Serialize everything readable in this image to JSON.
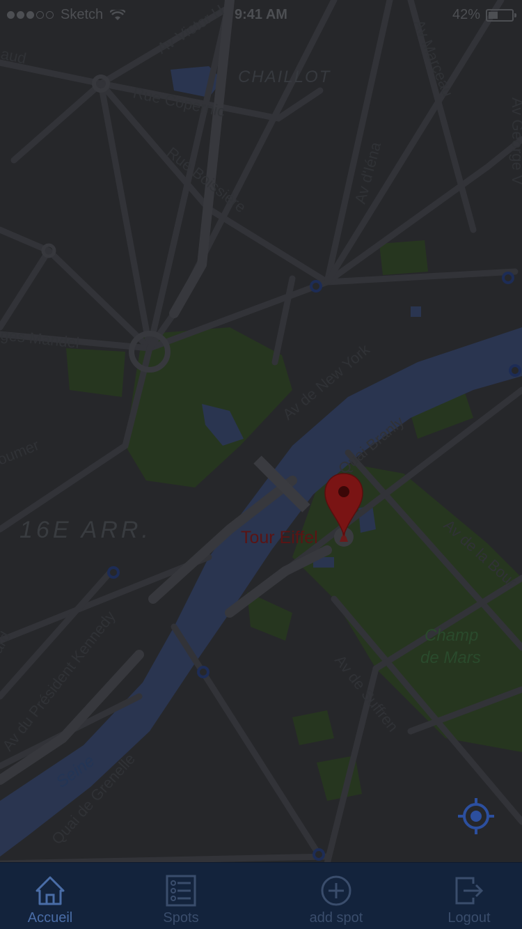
{
  "status_bar": {
    "carrier": "Sketch",
    "time": "9:41 AM",
    "battery": "42%",
    "battery_level": 0.42
  },
  "map": {
    "districts": {
      "chaillot": "CHAILLOT",
      "arr16": "16E ARR."
    },
    "streets": {
      "victor_hugo": "Av Victor H",
      "renaud": "aud",
      "copernic": "Rue Copernic",
      "boissiere": "Rue Boissière",
      "marceau": "Av Marceau",
      "iena": "Av d'Iéna",
      "george": "Av George V",
      "mandel": "ges Mandel",
      "new_york": "Av de New York",
      "branly": "Quai Branly",
      "doumer": "oumer",
      "bourdonnais": "Av de la Bour",
      "kennedy": "Av du Président Kennedy",
      "suffren": "Av de Suffren",
      "grenelle": "Quai de Grenelle",
      "ard": "ard"
    },
    "parks": {
      "champ_de_mars_line1": "Champ",
      "champ_de_mars_line2": "de Mars"
    },
    "water": {
      "seine": "Seine"
    },
    "poi": {
      "tour_eiffel": "Tour Eiffel"
    },
    "colors": {
      "road": "#2f3034",
      "block": "#252629",
      "park": "#26361f",
      "water": "#2a3550",
      "pin": "#7a1414",
      "accent": "#2c4f9e"
    }
  },
  "nav": {
    "home_label": "Accueil",
    "spots_label": "Spots",
    "add_label": "add spot",
    "logout_label": "Logout"
  },
  "icons": {
    "home": "home-icon",
    "spots": "list-icon",
    "add": "plus-circle-icon",
    "logout": "logout-icon",
    "locate": "crosshair-icon",
    "pin": "map-pin-icon",
    "metro": "metro-icon"
  }
}
